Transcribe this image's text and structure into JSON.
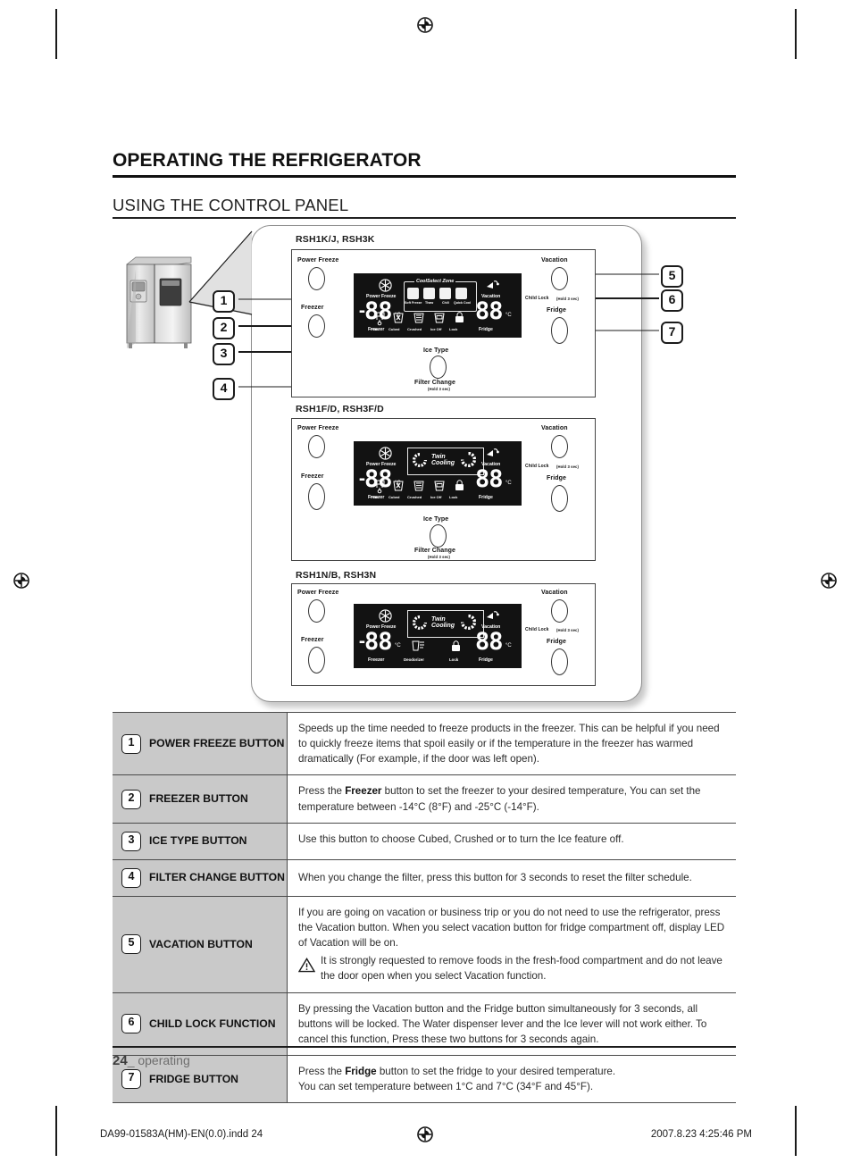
{
  "headings": {
    "h1": "OPERATING THE REFRIGERATOR",
    "h2": "USING THE CONTROL PANEL"
  },
  "callouts": [
    "1",
    "2",
    "3",
    "4",
    "5",
    "6",
    "7"
  ],
  "panels": [
    {
      "id": "panel-rsh1k",
      "title": "RSH1K/J, RSH3K",
      "buttons": {
        "power_freeze": "Power Freeze",
        "freezer": "Freezer",
        "ice_type": "Ice Type",
        "filter_change": "Filter Change",
        "filter_change_sub": "(Hold 3 sec)",
        "vacation": "Vacation",
        "child_lock": "Child Lock",
        "child_lock_sub": "(Hold 3 sec)",
        "fridge": "Fridge"
      },
      "lcd": {
        "power_freeze": "Power Freeze",
        "vacation": "Vacation",
        "freezer": "Freezer",
        "fridge": "Fridge",
        "freezer_value": "88",
        "fridge_value": "88",
        "unit": "°C",
        "minus": "-",
        "coolselect_title": "CoolSelect Zone",
        "coolselect_items": [
          "Soft Freeze",
          "Thaw",
          "Chill",
          "Quick Cool"
        ],
        "status_items": [
          "Filter",
          "Cubed",
          "Crushed",
          "Ice Off",
          "Lock"
        ]
      }
    },
    {
      "id": "panel-rsh1f",
      "title": "RSH1F/D, RSH3F/D",
      "buttons": {
        "power_freeze": "Power Freeze",
        "freezer": "Freezer",
        "ice_type": "Ice Type",
        "filter_change": "Filter Change",
        "filter_change_sub": "(Hold 3 sec)",
        "vacation": "Vacation",
        "child_lock": "Child Lock",
        "child_lock_sub": "(Hold 3 sec)",
        "fridge": "Fridge"
      },
      "lcd": {
        "power_freeze": "Power Freeze",
        "vacation": "Vacation",
        "freezer": "Freezer",
        "fridge": "Fridge",
        "freezer_value": "88",
        "fridge_value": "88",
        "unit": "°C",
        "minus": "-",
        "twin_cooling": "Twin Cooling",
        "status_items": [
          "Filter",
          "Cubed",
          "Crushed",
          "Ice Off",
          "Lock"
        ]
      }
    },
    {
      "id": "panel-rsh1n",
      "title": "RSH1N/B, RSH3N",
      "buttons": {
        "power_freeze": "Power Freeze",
        "freezer": "Freezer",
        "vacation": "Vacation",
        "child_lock": "Child Lock",
        "child_lock_sub": "(Hold 3 sec)",
        "fridge": "Fridge"
      },
      "lcd": {
        "power_freeze": "Power Freeze",
        "vacation": "Vacation",
        "freezer": "Freezer",
        "fridge": "Fridge",
        "freezer_value": "88",
        "fridge_value": "88",
        "unit": "°C",
        "minus": "-",
        "twin_cooling": "Twin Cooling",
        "status_items": [
          "Deodorizer",
          "Lock"
        ]
      }
    }
  ],
  "table": [
    {
      "num": "1",
      "name": "POWER FREEZE BUTTON",
      "body": "Speeds up the time needed to freeze products in the freezer. This can be helpful if you need to quickly freeze items that spoil easily or if the temperature in the freezer has warmed dramatically (For example, if the door was left open)."
    },
    {
      "num": "2",
      "name": "FREEZER BUTTON",
      "body_pre": "Press the ",
      "body_bold": "Freezer",
      "body_post": " button to set the freezer to your desired temperature, You can set the temperature between -14°C (8°F) and -25°C (-14°F)."
    },
    {
      "num": "3",
      "name": "ICE TYPE BUTTON",
      "body": "Use this button to choose Cubed, Crushed or to turn the Ice feature off."
    },
    {
      "num": "4",
      "name": "FILTER CHANGE BUTTON",
      "body": "When you change the filter, press this button for 3 seconds to reset the filter schedule."
    },
    {
      "num": "5",
      "name": "VACATION BUTTON",
      "body": "If you are going on vacation or business trip or you do not need to use the refrigerator, press the Vacation button. When you select vacation button for fridge compartment off, display LED of Vacation will be on.",
      "warning": "It is strongly requested to remove foods in the fresh-food compartment and do not leave the door open when you select Vacation function."
    },
    {
      "num": "6",
      "name": "CHILD LOCK FUNCTION",
      "body": "By pressing the Vacation button and the Fridge button simultaneously for 3 seconds, all buttons will be locked. The Water dispenser lever and the Ice lever will not work either. To cancel this function, Press these two buttons for 3 seconds again."
    },
    {
      "num": "7",
      "name": "FRIDGE BUTTON",
      "body_pre": "Press the ",
      "body_bold": "Fridge",
      "body_post": " button to set the fridge to your desired temperature.\nYou can set temperature between 1°C and 7°C (34°F and 45°F)."
    }
  ],
  "footer": {
    "page_number": "24",
    "page_suffix": "_ operating",
    "file_name": "DA99-01583A(HM)-EN(0.0).indd   24",
    "print_stamp": "2007.8.23   4:25:46 PM"
  }
}
